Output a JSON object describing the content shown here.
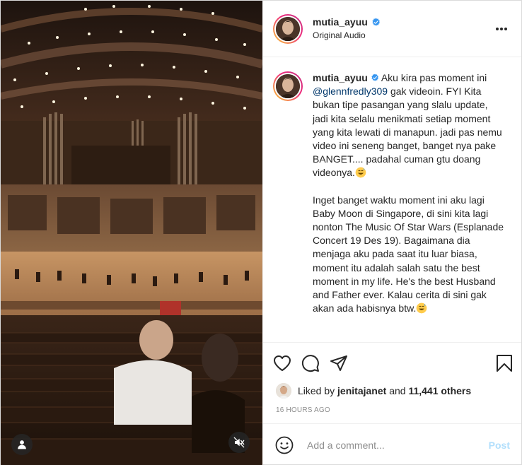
{
  "post": {
    "username": "mutia_ayuu",
    "verified": true,
    "audio_label": "Original Audio",
    "more_icon": "more-horizontal-icon"
  },
  "caption": {
    "username": "mutia_ayuu",
    "paragraph1_before_mention": "Aku kira pas moment ini ",
    "mention": "@glennfredly309",
    "paragraph1_after_mention": " gak videoin. FYI Kita bukan tipe pasangan yang slalu update, jadi kita selalu menikmati setiap moment yang kita lewati di manapun. jadi pas nemu video ini seneng banget, banget nya pake BANGET.... padahal cuman gtu doang videonya.",
    "paragraph2": "Inget banget waktu moment ini aku lagi Baby Moon di Singapore, di sini kita lagi nonton The Music Of Star Wars (Esplanade Concert 19 Des 19). Bagaimana dia menjaga aku pada saat itu luar biasa, moment itu adalah salah satu the best moment in my life. He's the best Husband and Father ever. Kalau cerita di sini gak akan ada habisnya btw.",
    "emoji_icon": "grinning-sweat-emoji"
  },
  "actions": {
    "like_icon": "heart-icon",
    "comment_icon": "comment-bubble-icon",
    "share_icon": "paper-plane-icon",
    "save_icon": "bookmark-icon"
  },
  "likes": {
    "prefix": "Liked by ",
    "user": "jenitajanet",
    "middle": " and ",
    "others": "11,441 others"
  },
  "timestamp": "16 HOURS AGO",
  "comment": {
    "placeholder": "Add a comment...",
    "post_label": "Post",
    "emoji_icon": "smiley-icon"
  },
  "media": {
    "tags_icon": "user-tag-icon",
    "mute_icon": "speaker-muted-icon"
  },
  "colors": {
    "link": "#00376b",
    "post_disabled": "#b2dffc",
    "verified": "#3897f0",
    "muted_text": "#8e8e8e"
  }
}
